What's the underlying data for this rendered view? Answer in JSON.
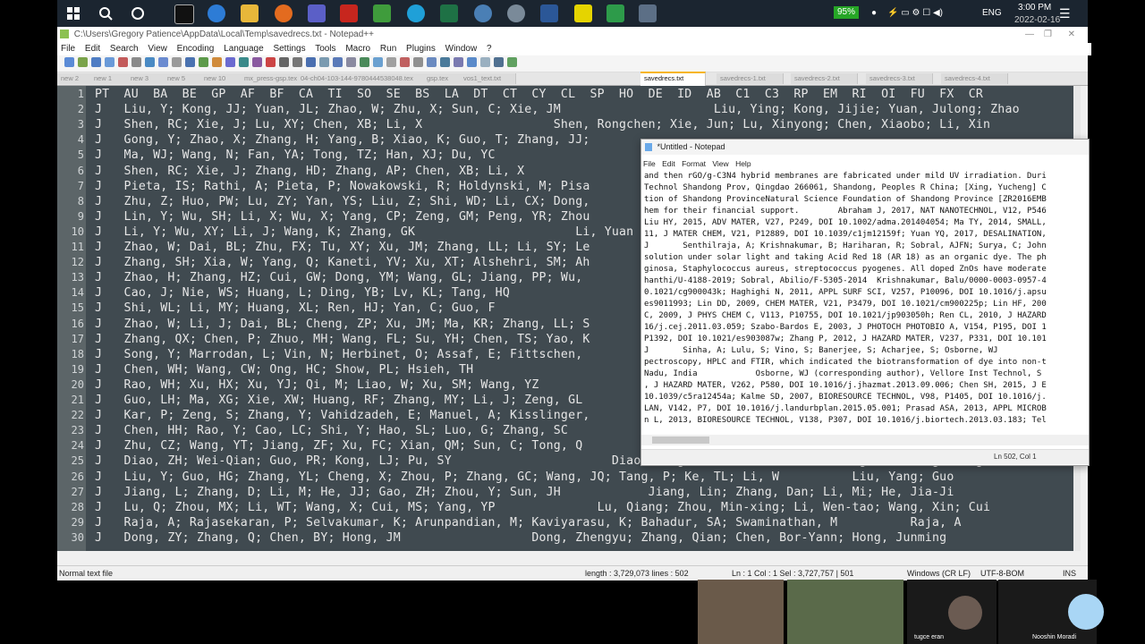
{
  "taskbar": {
    "battery": "95%",
    "language": "ENG",
    "time": "3:00 PM",
    "date": "2022-02-16"
  },
  "npp": {
    "title": "C:\\Users\\Gregory Patience\\AppData\\Local\\Temp\\savedrecs.txt - Notepad++",
    "menu": [
      "File",
      "Edit",
      "Search",
      "View",
      "Encoding",
      "Language",
      "Settings",
      "Tools",
      "Macro",
      "Run",
      "Plugins",
      "Window",
      "?"
    ],
    "tabs": [
      "new 2",
      "new 1",
      "new 3",
      "new 5",
      "new 10",
      "mx_press-gsp.tex",
      "04-ch04-103-144-9780444538048.tex",
      "gsp.tex",
      "vos1_text.txt",
      "savedrecs.txt",
      "savedrecs-1.txt",
      "savedrecs-2.txt",
      "savedrecs-3.txt",
      "savedrecs-4.txt"
    ],
    "active_tab": "savedrecs.txt",
    "lines": [
      {
        "n": "1",
        "t": "PT  AU  BA  BE  GP  AF  BF  CA  TI  SO  SE  BS  LA  DT  CT  CY  CL  SP  HO  DE  ID  AB  C1  C3  RP  EM  RI  OI  FU  FX  CR"
      },
      {
        "n": "2",
        "t": "J   Liu, Y; Kong, JJ; Yuan, JL; Zhao, W; Zhu, X; Sun, C; Xie, JM                     Liu, Ying; Kong, Jijie; Yuan, Julong; Zhao"
      },
      {
        "n": "3",
        "t": "J   Shen, RC; Xie, J; Lu, XY; Chen, XB; Li, X                  Shen, Rongchen; Xie, Jun; Lu, Xinyong; Chen, Xiaobo; Li, Xin"
      },
      {
        "n": "4",
        "t": "J   Gong, Y; Zhao, X; Zhang, H; Yang, B; Xiao, K; Guo, T; Zhang, JJ;"
      },
      {
        "n": "5",
        "t": "J   Ma, WJ; Wang, N; Fan, YA; Tong, TZ; Han, XJ; Du, YC"
      },
      {
        "n": "6",
        "t": "J   Shen, RC; Xie, J; Zhang, HD; Zhang, AP; Chen, XB; Li, X"
      },
      {
        "n": "7",
        "t": "J   Pieta, IS; Rathi, A; Pieta, P; Nowakowski, R; Holdynski, M; Pisa"
      },
      {
        "n": "8",
        "t": "J   Zhu, Z; Huo, PW; Lu, ZY; Yan, YS; Liu, Z; Shi, WD; Li, CX; Dong,"
      },
      {
        "n": "9",
        "t": "J   Lin, Y; Wu, SH; Li, X; Wu, X; Yang, CP; Zeng, GM; Peng, YR; Zhou"
      },
      {
        "n": "10",
        "t": "J   Li, Y; Wu, XY; Li, J; Wang, K; Zhang, GK                      Li, Yuan"
      },
      {
        "n": "11",
        "t": "J   Zhao, W; Dai, BL; Zhu, FX; Tu, XY; Xu, JM; Zhang, LL; Li, SY; Le"
      },
      {
        "n": "12",
        "t": "J   Zhang, SH; Xia, W; Yang, Q; Kaneti, YV; Xu, XT; Alshehri, SM; Ah"
      },
      {
        "n": "13",
        "t": "J   Zhao, H; Zhang, HZ; Cui, GW; Dong, YM; Wang, GL; Jiang, PP; Wu,"
      },
      {
        "n": "14",
        "t": "J   Cao, J; Nie, WS; Huang, L; Ding, YB; Lv, KL; Tang, HQ"
      },
      {
        "n": "15",
        "t": "J   Shi, WL; Li, MY; Huang, XL; Ren, HJ; Yan, C; Guo, F"
      },
      {
        "n": "16",
        "t": "J   Zhao, W; Li, J; Dai, BL; Cheng, ZP; Xu, JM; Ma, KR; Zhang, LL; S"
      },
      {
        "n": "17",
        "t": "J   Zhang, QX; Chen, P; Zhuo, MH; Wang, FL; Su, YH; Chen, TS; Yao, K"
      },
      {
        "n": "18",
        "t": "J   Song, Y; Marrodan, L; Vin, N; Herbinet, O; Assaf, E; Fittschen,"
      },
      {
        "n": "19",
        "t": "J   Chen, WH; Wang, CW; Ong, HC; Show, PL; Hsieh, TH"
      },
      {
        "n": "20",
        "t": "J   Rao, WH; Xu, HX; Xu, YJ; Qi, M; Liao, W; Xu, SM; Wang, YZ"
      },
      {
        "n": "21",
        "t": "J   Guo, LH; Ma, XG; Xie, XW; Huang, RF; Zhang, MY; Li, J; Zeng, GL"
      },
      {
        "n": "22",
        "t": "J   Kar, P; Zeng, S; Zhang, Y; Vahidzadeh, E; Manuel, A; Kisslinger,"
      },
      {
        "n": "23",
        "t": "J   Chen, HH; Rao, Y; Cao, LC; Shi, Y; Hao, SL; Luo, G; Zhang, SC"
      },
      {
        "n": "24",
        "t": "J   Zhu, CZ; Wang, YT; Jiang, ZF; Xu, FC; Xian, QM; Sun, C; Tong, Q"
      },
      {
        "n": "25",
        "t": "J   Diao, ZH; Wei-Qian; Guo, PR; Kong, LJ; Pu, SY                      Diao, Zeng-Hui; Wei-Qian; Guo, Peng-Ran; Kong, Ling-Jun;"
      },
      {
        "n": "26",
        "t": "J   Liu, Y; Guo, HG; Zhang, YL; Cheng, X; Zhou, P; Zhang, GC; Wang, JQ; Tang, P; Ke, TL; Li, W          Liu, Yang; Guo"
      },
      {
        "n": "27",
        "t": "J   Jiang, L; Zhang, D; Li, M; He, JJ; Gao, ZH; Zhou, Y; Sun, JH            Jiang, Lin; Zhang, Dan; Li, Mi; He, Jia-Ji"
      },
      {
        "n": "28",
        "t": "J   Lu, Q; Zhou, MX; Li, WT; Wang, X; Cui, MS; Yang, YP              Lu, Qiang; Zhou, Min-xing; Li, Wen-tao; Wang, Xin; Cui"
      },
      {
        "n": "29",
        "t": "J   Raja, A; Rajasekaran, P; Selvakumar, K; Arunpandian, M; Kaviyarasu, K; Bahadur, SA; Swaminathan, M          Raja, A"
      },
      {
        "n": "30",
        "t": "J   Dong, ZY; Zhang, Q; Chen, BY; Hong, JM                  Dong, Zhengyu; Zhang, Qian; Chen, Bor-Yann; Hong, Junming"
      }
    ],
    "status": {
      "type": "Normal text file",
      "length": "length : 3,729,073    lines : 502",
      "pos": "Ln : 1    Col : 1    Sel : 3,727,757 | 501",
      "eol": "Windows (CR LF)",
      "enc": "UTF-8-BOM",
      "mode": "INS"
    }
  },
  "notepad": {
    "title": "*Untitled - Notepad",
    "menu": [
      "File",
      "Edit",
      "Format",
      "View",
      "Help"
    ],
    "lines": [
      "and then rGO/g-C3N4 hybrid membranes are fabricated under mild UV irradiation. Duri",
      "Technol Shandong Prov, Qingdao 266061, Shandong, Peoples R China; [Xing, Yucheng] C",
      "tion of Shandong ProvinceNatural Science Foundation of Shandong Province [ZR2016EMB",
      "hem for their financial support.        Abraham J, 2017, NAT NANOTECHNOL, V12, P546",
      "Liu HY, 2015, ADV MATER, V27, P249, DOI 10.1002/adma.201404054; Ma TY, 2014, SMALL,",
      "11, J MATER CHEM, V21, P12889, DOI 10.1039/c1jm12159f; Yuan YQ, 2017, DESALINATION,",
      "J       Senthilraja, A; Krishnakumar, B; Hariharan, R; Sobral, AJFN; Surya, C; John",
      "solution under solar light and taking Acid Red 18 (AR 18) as an organic dye. The ph",
      "ginosa, Staphylococcus aureus, streptococcus pyogenes. All doped ZnOs have moderate",
      "hanthi/U-4188-2019; Sobral, Abilio/F-5305-2014  Krishnakumar, Balu/0000-0003-0957-4",
      "0.1021/cg900043k; Haghighi N, 2011, APPL SURF SCI, V257, P10096, DOI 10.1016/j.apsu",
      "es9011993; Lin DD, 2009, CHEM MATER, V21, P3479, DOI 10.1021/cm900225p; Lin HF, 200",
      "C, 2009, J PHYS CHEM C, V113, P10755, DOI 10.1021/jp903050h; Ren CL, 2010, J HAZARD",
      "16/j.cej.2011.03.059; Szabo-Bardos E, 2003, J PHOTOCH PHOTOBIO A, V154, P195, DOI 1",
      "P1392, DOI 10.1021/es903087w; Zhang P, 2012, J HAZARD MATER, V237, P331, DOI 10.101",
      "J       Sinha, A; Lulu, S; Vino, S; Banerjee, S; Acharjee, S; Osborne, WJ",
      "pectroscopy, HPLC and FTIR, which indicated the biotransformation of dye into non-t",
      "Nadu, India            Osborne, WJ (corresponding author), Vellore Inst Technol, S",
      ", J HAZARD MATER, V262, P580, DOI 10.1016/j.jhazmat.2013.09.006; Chen SH, 2015, J E",
      "10.1039/c5ra12454a; Kalme SD, 2007, BIORESOURCE TECHNOL, V98, P1405, DOI 10.1016/j.",
      "LAN, V142, P7, DOI 10.1016/j.landurbplan.2015.05.001; Prasad ASA, 2013, APPL MICROB",
      "n L, 2013, BIORESOURCE TECHNOL, V138, P307, DOI 10.1016/j.biortech.2013.03.183; Tel"
    ],
    "status": "Ln 502, Col 1"
  },
  "video": {
    "participants": [
      "tugce eran",
      "Nooshin Moradi"
    ]
  }
}
